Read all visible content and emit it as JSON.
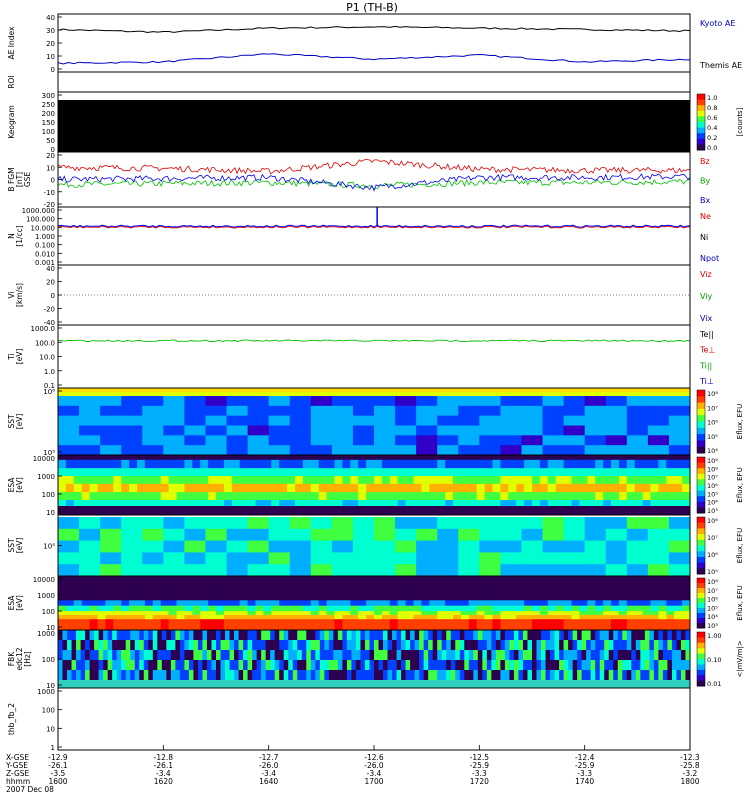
{
  "title": "P1 (TH-B)",
  "colors": {
    "black": "#000000",
    "red": "#e00000",
    "green": "#00c000",
    "blue": "#0000ff"
  },
  "colorscale": [
    "#2d0050",
    "#3000c8",
    "#0040ff",
    "#00b0ff",
    "#00ffd0",
    "#40ff40",
    "#e0ff00",
    "#ffb000",
    "#ff4000",
    "#ff0000"
  ],
  "panels": [
    {
      "key": "ae",
      "ylabel": [
        "AE Index"
      ],
      "ticks": [
        "40",
        "30",
        "20",
        "10",
        "0"
      ],
      "legend": [
        {
          "text": "Kyoto AE",
          "color": "#0000c0"
        },
        {
          "text": "Themis AE",
          "color": "#000000"
        }
      ]
    },
    {
      "key": "roi",
      "ylabel": [
        "ROI"
      ],
      "ticks": [],
      "legend": []
    },
    {
      "key": "kgram",
      "ylabel": [
        "Keogram"
      ],
      "ticks": [
        "300",
        "250",
        "200",
        "150",
        "100",
        "50",
        "0"
      ],
      "colorbar": {
        "ticks": [
          "1.0",
          "0.8",
          "0.6",
          "0.4",
          "0.2",
          "0.0"
        ],
        "label": "[counts]"
      }
    },
    {
      "key": "bfgm",
      "ylabel": [
        "B FGM",
        "[nT]",
        "GSE"
      ],
      "ticks": [
        "20",
        "10",
        "0",
        "-10",
        "-20"
      ],
      "legend": [
        {
          "text": "Bz",
          "color": "#e00000"
        },
        {
          "text": "By",
          "color": "#00a000"
        },
        {
          "text": "Bx",
          "color": "#0000c0"
        }
      ]
    },
    {
      "key": "dens",
      "ylabel": [
        "N",
        "[1/cc]"
      ],
      "ticks": [
        "1000.000",
        "100.000",
        "10.000",
        "1.000",
        "0.100",
        "0.010",
        "0.001"
      ],
      "legend": [
        {
          "text": "Ne",
          "color": "#e00000"
        },
        {
          "text": "Ni",
          "color": "#000000"
        },
        {
          "text": "Npot",
          "color": "#0000c0"
        }
      ]
    },
    {
      "key": "vel",
      "ylabel": [
        "Vi",
        "[km/s]"
      ],
      "ticks": [
        "40",
        "20",
        "0",
        "-20",
        "-40"
      ],
      "legend": [
        {
          "text": "Viz",
          "color": "#e00000"
        },
        {
          "text": "Viy",
          "color": "#00a000"
        },
        {
          "text": "Vix",
          "color": "#0000c0"
        }
      ]
    },
    {
      "key": "temp",
      "ylabel": [
        "Ti",
        "[eV]"
      ],
      "ticks": [
        "1000.0",
        "100.0",
        "10.0",
        "1.0",
        "0.1"
      ],
      "legend": [
        {
          "text": "Te||",
          "color": "#000000"
        },
        {
          "text": "Te⊥",
          "color": "#e00000"
        },
        {
          "text": "Ti||",
          "color": "#00a000"
        },
        {
          "text": "Ti⊥",
          "color": "#0000c0"
        }
      ]
    },
    {
      "key": "sste",
      "ylabel": [
        "SST",
        "[eV]"
      ],
      "ticks": [
        "10⁶",
        "10⁵"
      ],
      "colorbar": {
        "ticks": [
          "10⁸",
          "10⁷",
          "10⁶",
          "10⁵",
          "10⁴"
        ],
        "label": "Eflux, EFU"
      }
    },
    {
      "key": "esae",
      "ylabel": [
        "ESA",
        "[eV]"
      ],
      "ticks": [
        "10000",
        "1000",
        "100",
        "10"
      ],
      "colorbar": {
        "ticks": [
          "10⁹",
          "10⁸",
          "10⁷",
          "10⁶",
          "10⁵",
          "10⁴",
          "10³"
        ],
        "label": "Eflux, EFU"
      }
    },
    {
      "key": "ssti",
      "ylabel": [
        "SST",
        "[eV]"
      ],
      "ticks": [
        "10⁵"
      ],
      "colorbar": {
        "ticks": [
          "10⁸",
          "10⁷",
          "10⁶",
          "10⁵"
        ],
        "label": "Eflux, EFU"
      }
    },
    {
      "key": "esai",
      "ylabel": [
        "ESA",
        "[eV]"
      ],
      "ticks": [
        "10000",
        "1000",
        "100",
        "10"
      ],
      "colorbar": {
        "ticks": [
          "10⁸",
          "10⁷",
          "10⁶",
          "10⁵",
          "10⁴",
          "10³"
        ],
        "label": "Eflux, EFU"
      }
    },
    {
      "key": "fbk",
      "ylabel": [
        "FBK",
        "edc12",
        "[Hz]"
      ],
      "ticks": [
        "1000",
        "100",
        "10"
      ],
      "colorbar": {
        "ticks": [
          "1.00",
          "0.10",
          "0.01"
        ],
        "label": "<|mV/m|>"
      }
    },
    {
      "key": "fb2",
      "ylabel": [
        "thb_fb_2"
      ],
      "ticks": [
        "1000",
        "100",
        "10",
        "1"
      ]
    }
  ],
  "axis": {
    "rows": [
      {
        "label": "X-GSE",
        "values": [
          "-12.9",
          "-12.8",
          "-12.7",
          "-12.6",
          "-12.5",
          "-12.4",
          "-12.3"
        ]
      },
      {
        "label": "Y-GSE",
        "values": [
          "-26.1",
          "-26.1",
          "-26.0",
          "-26.0",
          "-25.9",
          "-25.9",
          "-25.8"
        ]
      },
      {
        "label": "Z-GSE",
        "values": [
          "-3.5",
          "-3.4",
          "-3.4",
          "-3.4",
          "-3.3",
          "-3.3",
          "-3.2"
        ]
      },
      {
        "label": "hhmm",
        "values": [
          "1600",
          "1620",
          "1640",
          "1700",
          "1720",
          "1740",
          "1800"
        ]
      }
    ],
    "date": "2007 Dec 08"
  },
  "chart_data": [
    {
      "type": "line",
      "title": "P1 (TH-B)",
      "ylabel": "AE Index",
      "ylim": [
        0,
        40
      ],
      "x": [
        "1600",
        "1620",
        "1640",
        "1700",
        "1720",
        "1740",
        "1800"
      ],
      "series": [
        {
          "name": "Kyoto AE",
          "values": [
            30,
            28,
            31,
            32,
            31,
            30,
            29
          ]
        },
        {
          "name": "Themis AE",
          "values": [
            5,
            6,
            12,
            8,
            11,
            6,
            8
          ]
        }
      ]
    },
    {
      "type": "line",
      "ylabel": "B FGM [nT] GSE",
      "ylim": [
        -25,
        25
      ],
      "x": [
        "1600",
        "1620",
        "1640",
        "1700",
        "1720",
        "1740",
        "1800"
      ],
      "series": [
        {
          "name": "Bz",
          "values": [
            12,
            11,
            8,
            18,
            10,
            9,
            9
          ]
        },
        {
          "name": "By",
          "values": [
            -5,
            -4,
            -3,
            -6,
            -3,
            -3,
            -2
          ]
        },
        {
          "name": "Bx",
          "values": [
            0,
            1,
            2,
            -8,
            2,
            2,
            3
          ]
        }
      ]
    },
    {
      "type": "line",
      "ylabel": "N [1/cc]",
      "ylim": [
        0.001,
        1000
      ],
      "x": [
        "1600",
        "1620",
        "1640",
        "1700",
        "1720",
        "1740",
        "1800"
      ],
      "series": [
        {
          "name": "Ne",
          "values": [
            10,
            10,
            10,
            10,
            10,
            10,
            10
          ]
        },
        {
          "name": "Ni",
          "values": [
            10,
            10,
            10,
            10,
            10,
            10,
            10
          ]
        }
      ]
    },
    {
      "type": "line",
      "ylabel": "Ti [eV]",
      "ylim": [
        0.1,
        1000
      ],
      "x": [
        "1600",
        "1620",
        "1640",
        "1700",
        "1720",
        "1740",
        "1800"
      ],
      "series": [
        {
          "name": "Ti||",
          "values": [
            200,
            200,
            210,
            200,
            205,
            200,
            200
          ]
        }
      ]
    }
  ]
}
